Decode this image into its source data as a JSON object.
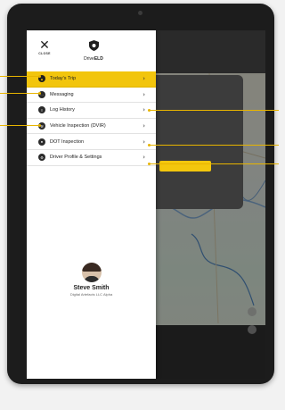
{
  "drawer": {
    "close_label": "CLOSE",
    "logo_text_light": "Drive",
    "logo_text_bold": "ELD",
    "menu": [
      {
        "label": "Today's Trip",
        "icon": "truck-icon",
        "active": true
      },
      {
        "label": "Messaging",
        "icon": "chat-icon",
        "active": false
      },
      {
        "label": "Log History",
        "icon": "log-icon",
        "active": false
      },
      {
        "label": "Vehicle Inspection (DVIR)",
        "icon": "wrench-icon",
        "active": false
      },
      {
        "label": "DOT Inspection",
        "icon": "badge-icon",
        "active": false
      },
      {
        "label": "Driver Profile & Settings",
        "icon": "gear-icon",
        "active": false
      }
    ],
    "chevron": "›",
    "profile": {
      "name": "Steve Smith",
      "company": "Digital Artefacts LLC Alpha"
    }
  },
  "colors": {
    "accent": "#f2c50d",
    "callout": "#e7b400",
    "bezel": "#1c1c1c"
  }
}
